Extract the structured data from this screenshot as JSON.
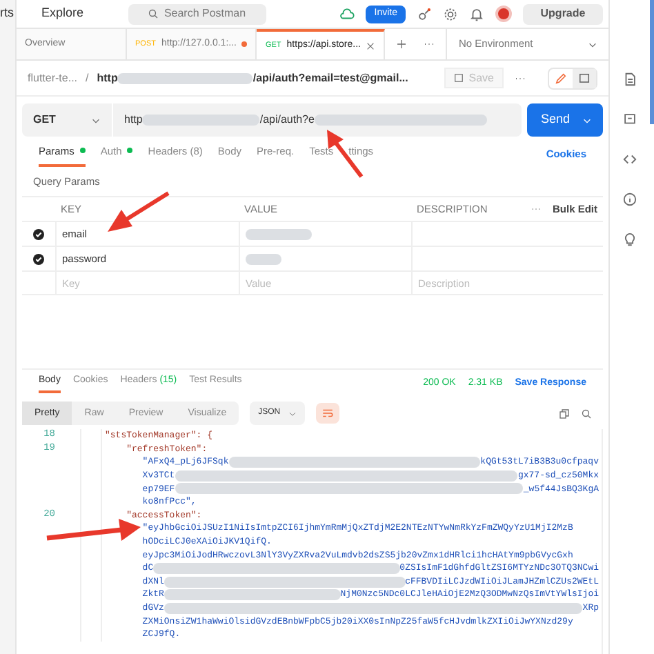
{
  "topbar": {
    "nav_partial": "rts",
    "explore": "Explore",
    "search_placeholder": "Search Postman",
    "invite": "Invite",
    "upgrade": "Upgrade"
  },
  "tabs": [
    {
      "kind": "plain",
      "label": "Overview",
      "selected": false
    },
    {
      "kind": "request",
      "method": "POST",
      "label": "http://127.0.0.1:...",
      "unsaved": true,
      "selected": false
    },
    {
      "kind": "request",
      "method": "GET",
      "label": "https://api.store...",
      "unsaved": false,
      "selected": true
    }
  ],
  "environment": "No Environment",
  "breadcrumb": {
    "collection": "flutter-te...",
    "separator": "/",
    "request_start": "http",
    "request_end": "/api/auth?email=test@gmail...",
    "save": "Save"
  },
  "request": {
    "method": "GET",
    "url_start": "http",
    "url_end": "/api/auth?e",
    "send": "Send"
  },
  "request_tabs": [
    {
      "label": "Params",
      "dot": true,
      "selected": true
    },
    {
      "label": "Auth",
      "dot": true,
      "selected": false
    },
    {
      "label": "Headers (8)",
      "dot": false,
      "selected": false
    },
    {
      "label": "Body",
      "dot": false,
      "selected": false
    },
    {
      "label": "Pre-req.",
      "dot": false,
      "selected": false
    },
    {
      "label": "Tests",
      "dot": false,
      "selected": false
    },
    {
      "label": "ttings",
      "dot": false,
      "selected": false
    }
  ],
  "cookies": "Cookies",
  "query_params": {
    "title": "Query Params",
    "columns": [
      "KEY",
      "VALUE",
      "DESCRIPTION"
    ],
    "bulk_edit": "Bulk Edit",
    "rows": [
      {
        "key": "email",
        "checked": true
      },
      {
        "key": "password",
        "checked": true
      }
    ],
    "placeholders": [
      "Key",
      "Value",
      "Description"
    ]
  },
  "response": {
    "tabs": [
      {
        "label": "Body",
        "selected": true
      },
      {
        "label": "Cookies",
        "selected": false
      },
      {
        "label": "Headers",
        "count": "(15)",
        "selected": false
      },
      {
        "label": "Test Results",
        "selected": false
      }
    ],
    "status": "200 OK",
    "size": "2.31 KB",
    "save_response": "Save Response",
    "view_modes": [
      {
        "label": "Pretty",
        "selected": true
      },
      {
        "label": "Raw",
        "selected": false
      },
      {
        "label": "Preview",
        "selected": false
      },
      {
        "label": "Visualize",
        "selected": false
      }
    ],
    "format": "JSON",
    "lines": [
      {
        "number": "18",
        "kind": "key",
        "text": "\"stsTokenManager\": {"
      },
      {
        "number": "19",
        "kind": "key",
        "text": "    \"refreshToken\":"
      },
      {
        "kind": "string",
        "text": "       \"AFxQ4_pLj6JFSqk",
        "tail": "kQGt53tL7iB3B3u0cfpaqv"
      },
      {
        "kind": "string",
        "text": "       Xv3TCt",
        "tail": "gx77-sd_cz50Mkx"
      },
      {
        "kind": "string",
        "text": "       ep79EF",
        "tail": "_w5f44JsBQ3KgA"
      },
      {
        "kind": "string",
        "text": "       ko8nfPcc\","
      },
      {
        "number": "20",
        "kind": "key",
        "text": "    \"accessToken\":"
      },
      {
        "kind": "string",
        "text": "       \"eyJhbGciOiJSUzI1NiIsImtpZCI6IjhmYmRmMjQxZTdjM2E2NTEzNTYwNmRkYzFmZWQyYzU1MjI2MzB"
      },
      {
        "kind": "string",
        "text": "       hODciLCJ0eXAiOiJKV1QifQ."
      },
      {
        "kind": "string",
        "text": "       eyJpc3MiOiJodHRwczovL3NlY3VyZXRva2VuLmdvb2dsZS5jb20vZmx1dHRlci1hcHAtYm9pbGVycGxh"
      },
      {
        "kind": "string",
        "text": "       dC",
        "tail": "0ZSIsImF1dGhfdGltZSI6MTYzNDc3OTQ3NCwi"
      },
      {
        "kind": "string",
        "text": "       dXNl",
        "tail": "cFFBVDIiLCJzdWIiOiJLamJHZmlCZUs2WEtL"
      },
      {
        "kind": "string",
        "text": "       ZktR",
        "tail": "NjM0Nzc5NDc0LCJleHAiOjE2MzQ3ODMwNzQsImVtYWlsIjoi"
      },
      {
        "kind": "string",
        "text": "       dGVz",
        "tail": "XRp"
      },
      {
        "kind": "string",
        "text": "       ZXMiOnsiZW1haWwiOlsidGVzdEBnbWFpbC5jb20iXX0sInNpZ25faW5fcHJvdmlkZXIiOiJwYXNzd29y"
      },
      {
        "kind": "string",
        "text": "       ZCJ9fQ."
      }
    ]
  }
}
